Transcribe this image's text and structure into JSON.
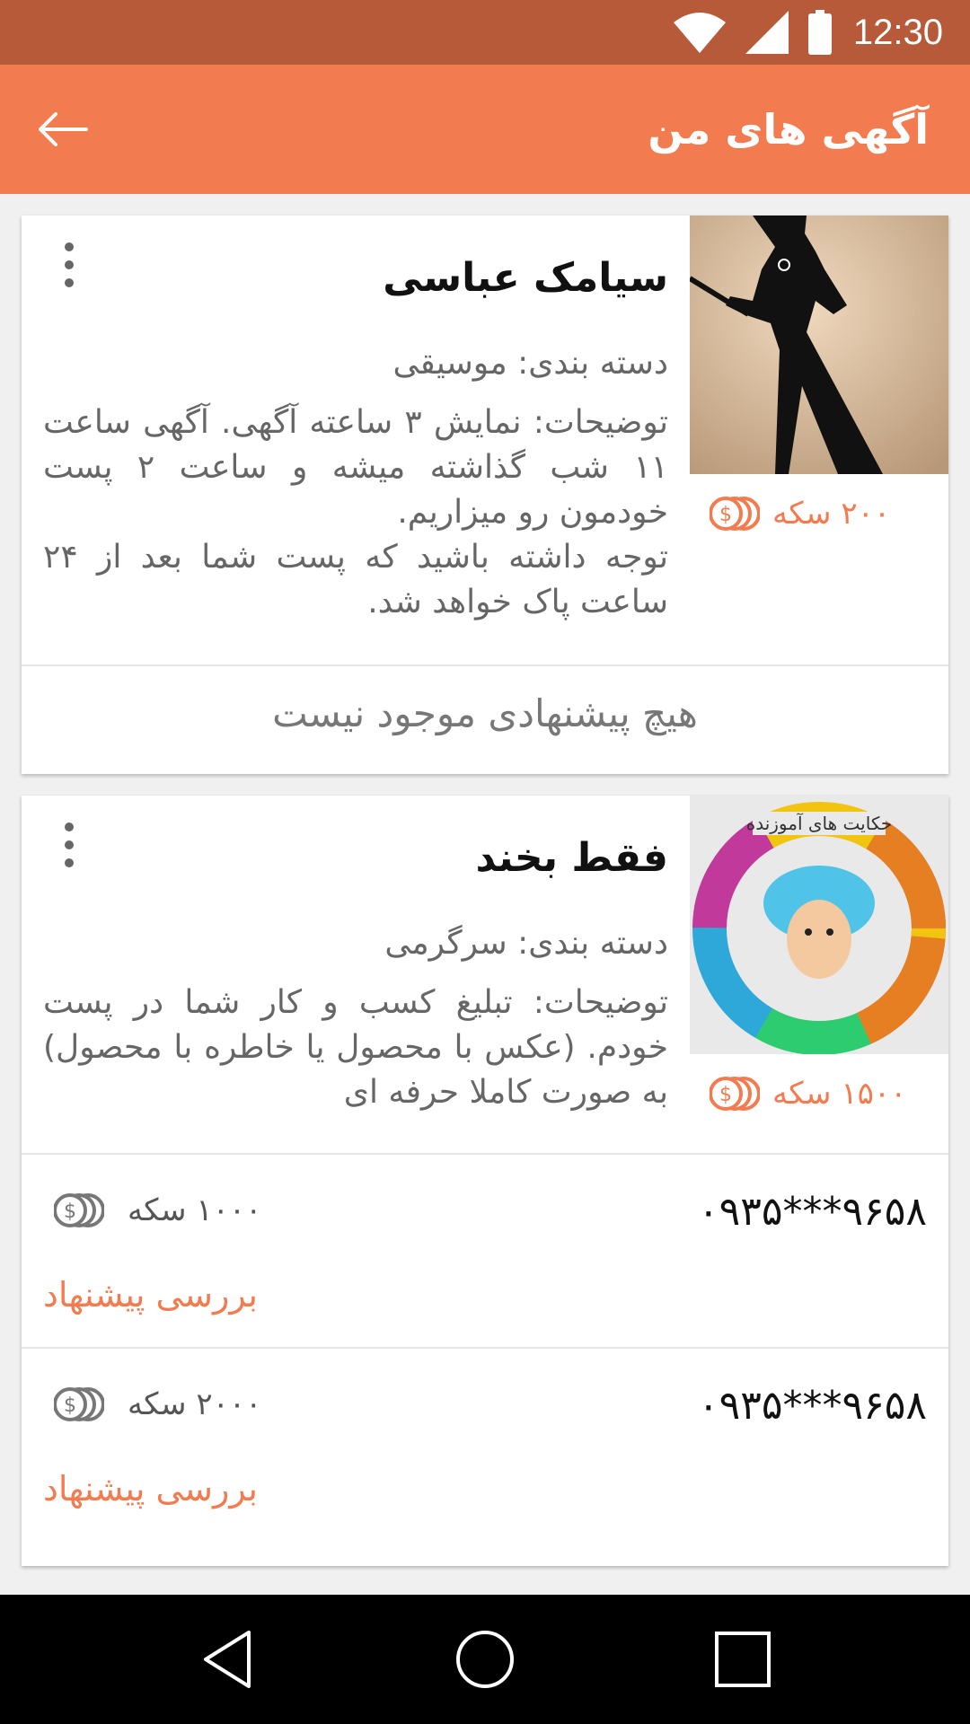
{
  "status_bar": {
    "time": "12:30",
    "icons": [
      "wifi-icon",
      "signal-icon",
      "battery-icon"
    ]
  },
  "app_bar": {
    "title": "آگهی های من",
    "back_icon": "arrow-back-icon"
  },
  "ads": [
    {
      "name": "سیامک عباسی",
      "category": "دسته بندی: موسیقی",
      "description_lines": [
        "توضیحات: نمایش ۳ ساعته آگهی. آگهی ساعت ۱۱ شب گذاشته میشه و ساعت ۲ پست خودمون رو میزاریم.",
        "توجه داشته باشید که پست شما بعد از ۲۴ ساعت پاک خواهد شد."
      ],
      "price": "۲۰۰ سکه",
      "no_offers": "هیچ پیشنهادی موجود نیست"
    },
    {
      "name": "فقط بخند",
      "category": "دسته بندی: سرگرمی",
      "description_lines": [
        "توضیحات: تبلیغ کسب و کار شما در پست خودم. (عکس با محصول یا خاطره با محصول) به صورت کاملا حرفه ای"
      ],
      "price": "۱۵۰۰ سکه",
      "image_text": "حکایت های آموزنده",
      "offers": [
        {
          "phone": "۰۹۳۵***۹۶۵۸",
          "amount": "۱۰۰۰ سکه",
          "action": "بررسی پیشنهاد"
        },
        {
          "phone": "۰۹۳۵***۹۶۵۸",
          "amount": "۲۰۰۰ سکه",
          "action": "بررسی پیشنهاد"
        }
      ]
    }
  ],
  "colors": {
    "accent": "#f27c4f",
    "status": "#b75a39",
    "background": "#f0f0f0"
  },
  "nav": {
    "back": "nav-back-icon",
    "home": "nav-home-icon",
    "recents": "nav-recents-icon"
  }
}
